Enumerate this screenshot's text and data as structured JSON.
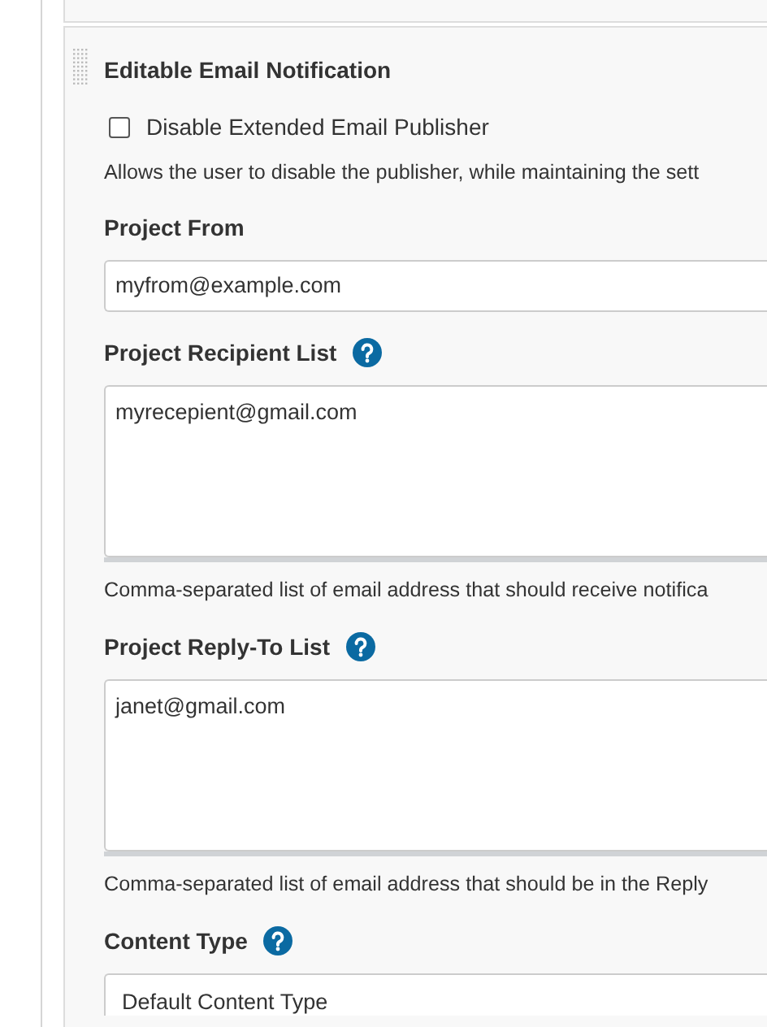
{
  "section": {
    "title": "Editable Email Notification"
  },
  "disable_checkbox": {
    "label": "Disable Extended Email Publisher",
    "checked": false
  },
  "disable_help": "Allows the user to disable the publisher, while maintaining the sett",
  "fields": [
    {
      "kind": "input",
      "label": "Project From",
      "help_icon": false,
      "value": "myfrom@example.com"
    },
    {
      "kind": "textarea",
      "label": "Project Recipient List",
      "help_icon": true,
      "value": "myrecepient@gmail.com",
      "help": "Comma-separated list of email address that should receive notifica"
    },
    {
      "kind": "textarea",
      "label": "Project Reply-To List",
      "help_icon": true,
      "value": "janet@gmail.com",
      "help": "Comma-separated list of email address that should be in the Reply"
    },
    {
      "kind": "select",
      "label": "Content Type",
      "help_icon": true,
      "value": "Default Content Type"
    }
  ]
}
